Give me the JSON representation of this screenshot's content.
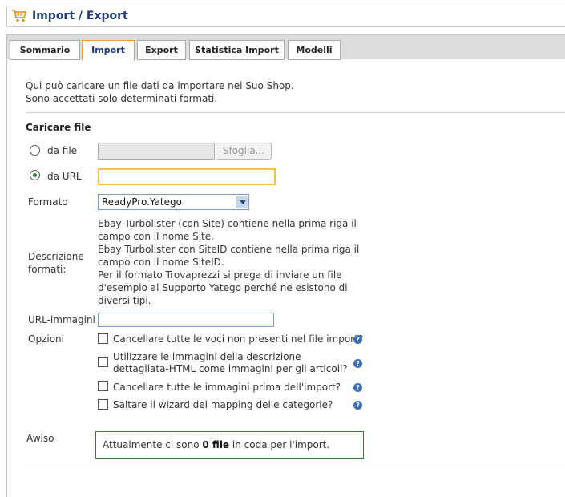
{
  "header": {
    "title": "Import / Export",
    "icon": "cart-icon"
  },
  "tabs": [
    {
      "label": "Sommario",
      "active": false
    },
    {
      "label": "Import",
      "active": true
    },
    {
      "label": "Export",
      "active": false
    },
    {
      "label": "Statistica Import",
      "active": false
    },
    {
      "label": "Modelli",
      "active": false
    }
  ],
  "intro": {
    "line1": "Qui può caricare un file dati da importare nel Suo Shop.",
    "line2": "Sono accettati solo determinati formati."
  },
  "upload": {
    "title": "Caricare file",
    "from_file_label": "da file",
    "browse_label": "Sfoglia...",
    "from_url_label": "da URL",
    "selected_source": "da URL",
    "url_value": ""
  },
  "format": {
    "label": "Formato",
    "selected": "ReadyPro.Yatego"
  },
  "description": {
    "label_line1": "Descrizione",
    "label_line2": "formati:",
    "lines": [
      "Ebay Turbolister (con Site) contiene nella prima riga il",
      "campo con il nome Site.",
      "Ebay Turbolister con SiteID contiene nella prima riga il",
      "campo con il nome SiteID.",
      "Per il formato Trovaprezzi si prega di inviare un file",
      "d'esempio al Supporto Yatego perché ne esistono di",
      "diversi tipi."
    ]
  },
  "images_url": {
    "label": "URL-immagini",
    "value": ""
  },
  "options": {
    "label": "Opzioni",
    "items": [
      {
        "line1": "Cancellare tutte le voci non presenti nel file import?",
        "line2": "",
        "checked": false
      },
      {
        "line1": "Utilizzare le immagini della descrizione",
        "line2": "dettagliata-HTML come immagini per gli articoli?",
        "checked": false
      },
      {
        "line1": "Cancellare tutte le immagini prima dell'import?",
        "line2": "",
        "checked": false
      },
      {
        "line1": "Saltare il wizard del mapping delle categorie?",
        "line2": "",
        "checked": false
      }
    ],
    "help_glyph": "?"
  },
  "notice": {
    "label": "Awiso",
    "text_before": "Attualmente ci sono ",
    "text_bold": "0 file",
    "text_after": " in coda per l'import."
  },
  "colors": {
    "title_blue": "#1f3a78",
    "active_tab_border": "#f0a040",
    "url_field_border": "#f5c04a",
    "notice_border": "#2e7d32",
    "help_icon": "#3d6fb8"
  }
}
